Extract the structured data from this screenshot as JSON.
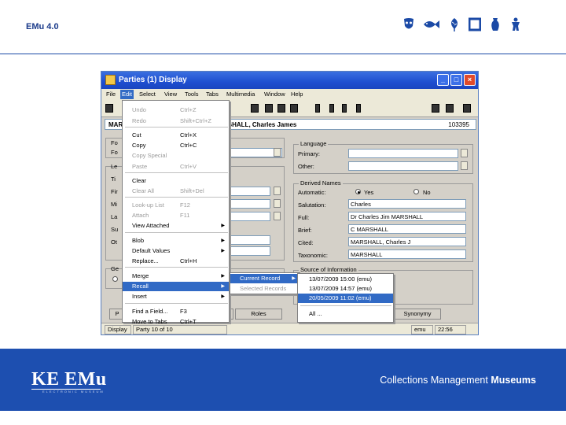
{
  "header": {
    "title": "EMu 4.0",
    "icons": [
      "mask-icon",
      "fish-icon",
      "leaf-icon",
      "frame-icon",
      "vase-icon",
      "figure-icon"
    ]
  },
  "footer": {
    "logo": "KE EMu",
    "logo_sub": "ELECTRONIC MUSEUM",
    "tagline_prefix": "Collections Management",
    "tagline_bold": "Museums"
  },
  "window": {
    "title": "Parties (1)   Display",
    "menu": [
      "File",
      "Edit",
      "Select",
      "View",
      "Tools",
      "Tabs",
      "Multimedia",
      "Window",
      "Help"
    ],
    "record_left": "MAR",
    "record_name": "RSHALL, Charles James",
    "record_id": "103395",
    "groups": {
      "language": "Language",
      "primary_label": "Primary:",
      "other_label": "Other:",
      "derived_names": "Derived Names",
      "automatic_label": "Automatic:",
      "yes_label": "Yes",
      "no_label": "No",
      "salutation_label": "Salutation:",
      "salutation_value": "Charles",
      "full_label": "Full:",
      "full_value": "Dr Charles Jim MARSHALL",
      "brief_label": "Brief:",
      "brief_value": "C MARSHALL",
      "cited_label": "Cited:",
      "cited_value": "MARSHALL, Charles J",
      "taxonomic_label": "Taxonomic:",
      "taxonomic_value": "MARSHALL",
      "source_info": "Source of Information"
    },
    "left_labels": [
      "Fo",
      "Fo",
      "Le",
      "Ti",
      "Fir",
      "Mi",
      "La",
      "Su",
      "Ot",
      "Ge"
    ],
    "tabs": [
      "P",
      "ses",
      "Roles",
      "Synonymy"
    ],
    "status": {
      "mode": "Display",
      "party": "Party 10 of 10",
      "user": "emu",
      "time": "22:56"
    }
  },
  "edit_menu": [
    {
      "label": "Undo",
      "key": "Ctrl+Z",
      "disabled": true
    },
    {
      "label": "Redo",
      "key": "Shift+Ctrl+Z",
      "disabled": true
    },
    {
      "label": "Cut",
      "key": "Ctrl+X",
      "disabled": false
    },
    {
      "label": "Copy",
      "key": "Ctrl+C",
      "disabled": false
    },
    {
      "label": "Copy Special",
      "key": "",
      "disabled": true
    },
    {
      "label": "Paste",
      "key": "Ctrl+V",
      "disabled": true
    },
    {
      "label": "Clear",
      "key": "",
      "disabled": false
    },
    {
      "label": "Clear All",
      "key": "Shift+Del",
      "disabled": true
    },
    {
      "label": "Look-up List",
      "key": "F12",
      "disabled": true
    },
    {
      "label": "Attach",
      "key": "F11",
      "disabled": true
    },
    {
      "label": "View Attached",
      "key": "",
      "disabled": false
    },
    {
      "label": "Blob",
      "key": "",
      "disabled": false
    },
    {
      "label": "Default Values",
      "key": "",
      "disabled": false
    },
    {
      "label": "Replace...",
      "key": "Ctrl+H",
      "disabled": false
    },
    {
      "label": "Merge",
      "key": "",
      "disabled": false
    },
    {
      "label": "Recall",
      "key": "",
      "disabled": false
    },
    {
      "label": "Insert",
      "key": "",
      "disabled": false
    },
    {
      "label": "Find a Field...",
      "key": "F3",
      "disabled": false
    },
    {
      "label": "Move to Tabs",
      "key": "Ctrl+T",
      "disabled": false
    }
  ],
  "recall_submenu": [
    {
      "label": "Current Record"
    },
    {
      "label": "Selected Records"
    }
  ],
  "recall_history": [
    {
      "label": "13/07/2009  15:00 (emu)"
    },
    {
      "label": "13/07/2009  14:57 (emu)"
    },
    {
      "label": "20/05/2009  11:02 (emu)"
    },
    {
      "label": "All ..."
    }
  ],
  "colors": {
    "brand_blue": "#1d4fb0",
    "menu_highlight": "#316ac5"
  }
}
